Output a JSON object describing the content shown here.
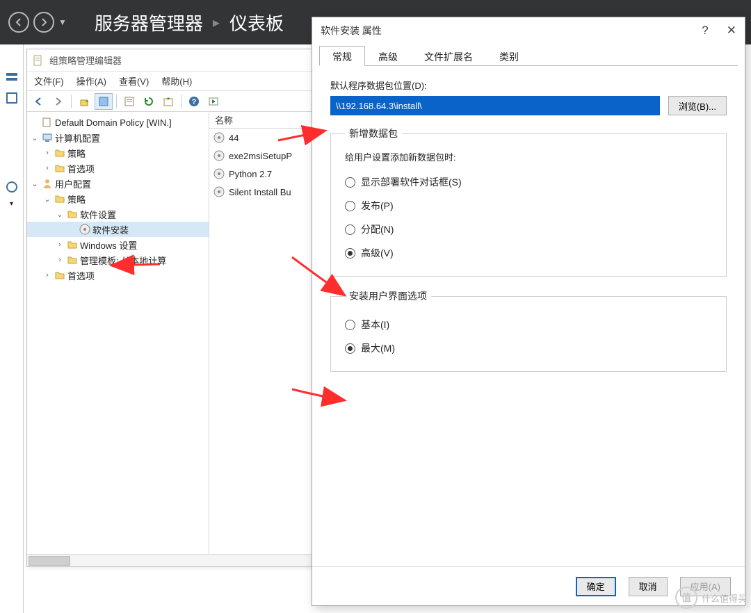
{
  "banner": {
    "title_main": "服务器管理器",
    "title_sub": "仪表板"
  },
  "gpme": {
    "window_title": "组策略管理编辑器",
    "menu": {
      "file": "文件(F)",
      "action": "操作(A)",
      "view": "查看(V)",
      "help": "帮助(H)"
    },
    "tree": {
      "root": "Default Domain Policy [WIN.]",
      "computer_cfg": "计算机配置",
      "user_cfg": "用户配置",
      "policies": "策略",
      "prefs": "首选项",
      "software_settings": "软件设置",
      "software_install": "软件安装",
      "windows_settings": "Windows 设置",
      "admin_templates": "管理模板: 从本地计算"
    },
    "list_header": "名称",
    "items": [
      {
        "label": "44"
      },
      {
        "label": "exe2msiSetupP"
      },
      {
        "label": "Python 2.7"
      },
      {
        "label": "Silent Install Bu"
      }
    ]
  },
  "props": {
    "title": "软件安装 属性",
    "tabs": {
      "general": "常规",
      "advanced": "高级",
      "ext": "文件扩展名",
      "category": "类别"
    },
    "default_loc_label": "默认程序数据包位置(D):",
    "default_loc_value": "\\\\192.168.64.3\\install\\",
    "browse": "浏览(B)...",
    "group_new": {
      "legend": "新增数据包",
      "hint": "给用户设置添加新数据包时:",
      "deploy_dialog": "显示部署软件对话框(S)",
      "publish": "发布(P)",
      "assign": "分配(N)",
      "advanced": "高级(V)"
    },
    "group_ui": {
      "legend": "安装用户界面选项",
      "basic": "基本(I)",
      "max": "最大(M)"
    },
    "buttons": {
      "ok": "确定",
      "cancel": "取消",
      "apply": "应用(A)"
    }
  },
  "watermark": "什么值得买"
}
